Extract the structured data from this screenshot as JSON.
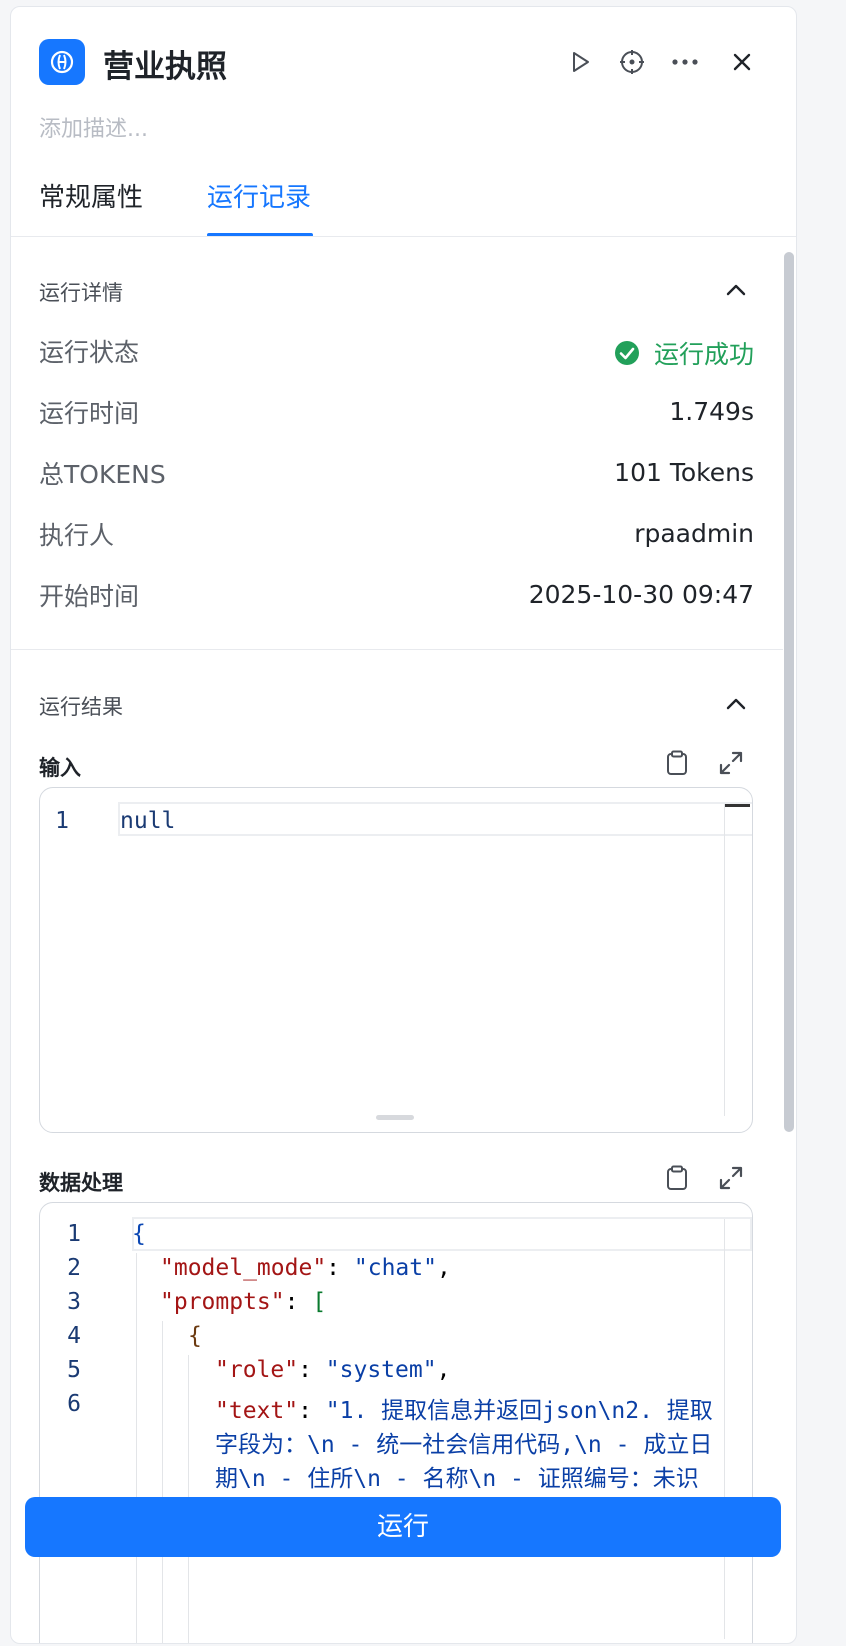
{
  "header": {
    "title": "营业执照",
    "description_placeholder": "添加描述...",
    "icons": [
      "run-icon",
      "locate-icon",
      "more-icon",
      "close-icon"
    ]
  },
  "tabs": [
    {
      "label": "常规属性",
      "active": false
    },
    {
      "label": "运行记录",
      "active": true
    }
  ],
  "run_details": {
    "heading": "运行详情",
    "rows": [
      {
        "label": "运行状态",
        "value": "运行成功"
      },
      {
        "label": "运行时间",
        "value": "1.749s"
      },
      {
        "label": "总TOKENS",
        "value": "101 Tokens"
      },
      {
        "label": "执行人",
        "value": "rpaadmin"
      },
      {
        "label": "开始时间",
        "value": "2025-10-30 09:47"
      }
    ]
  },
  "run_result": {
    "heading": "运行结果",
    "input": {
      "title": "输入",
      "lines": [
        "null"
      ]
    },
    "processing": {
      "title": "数据处理",
      "line_numbers": [
        "1",
        "2",
        "3",
        "4",
        "5",
        "6"
      ],
      "code": {
        "l1": "{",
        "l2_key": "\"model_mode\"",
        "l2_rest": ": ",
        "l2_val": "\"chat\"",
        "l2_end": ",",
        "l3_key": "\"prompts\"",
        "l3_rest": ": ",
        "l3_br": "[",
        "l4": "{",
        "l5_key": "\"role\"",
        "l5_rest": ": ",
        "l5_val": "\"system\"",
        "l5_end": ",",
        "l6_key": "\"text\"",
        "l6_rest": ": ",
        "l6_val_a": "\"1. 提取信息并返回json\\n2. 提取",
        "l6_val_b": "字段为：\\n - 统一社会信用代码,\\n - 成立日",
        "l6_val_c": "期\\n - 住所\\n - 名称\\n - 证照编号：未识"
      }
    }
  },
  "footer": {
    "run_label": "运行"
  },
  "colors": {
    "accent": "#1677ff",
    "success": "#22a05a"
  }
}
